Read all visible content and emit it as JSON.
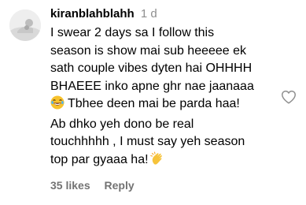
{
  "comment": {
    "username": "kiranblahblahh",
    "time": "1 d",
    "lines": [
      "I swear 2 days sa I follow this",
      "season is show mai sub heeeee ek",
      "sath couple vibes dyten hai OHHHH",
      "BHAEEE inko apne ghr nae jaanaaa",
      "Tbhee deen mai be parda haa!",
      "Ab dhko yeh dono be real",
      "touchhhhh , I must say yeh season",
      "top par gyaaa ha!"
    ],
    "emojis": [
      "laughing-face-emoji",
      "clapping-hands-emoji"
    ],
    "likes": "35 likes",
    "reply_label": "Reply"
  },
  "colors": {
    "text": "#000000",
    "meta": "#8e8e8e",
    "action": "#737373",
    "laugh_emoji": "#f7c22c",
    "clap_emoji": "#f6c33b"
  }
}
